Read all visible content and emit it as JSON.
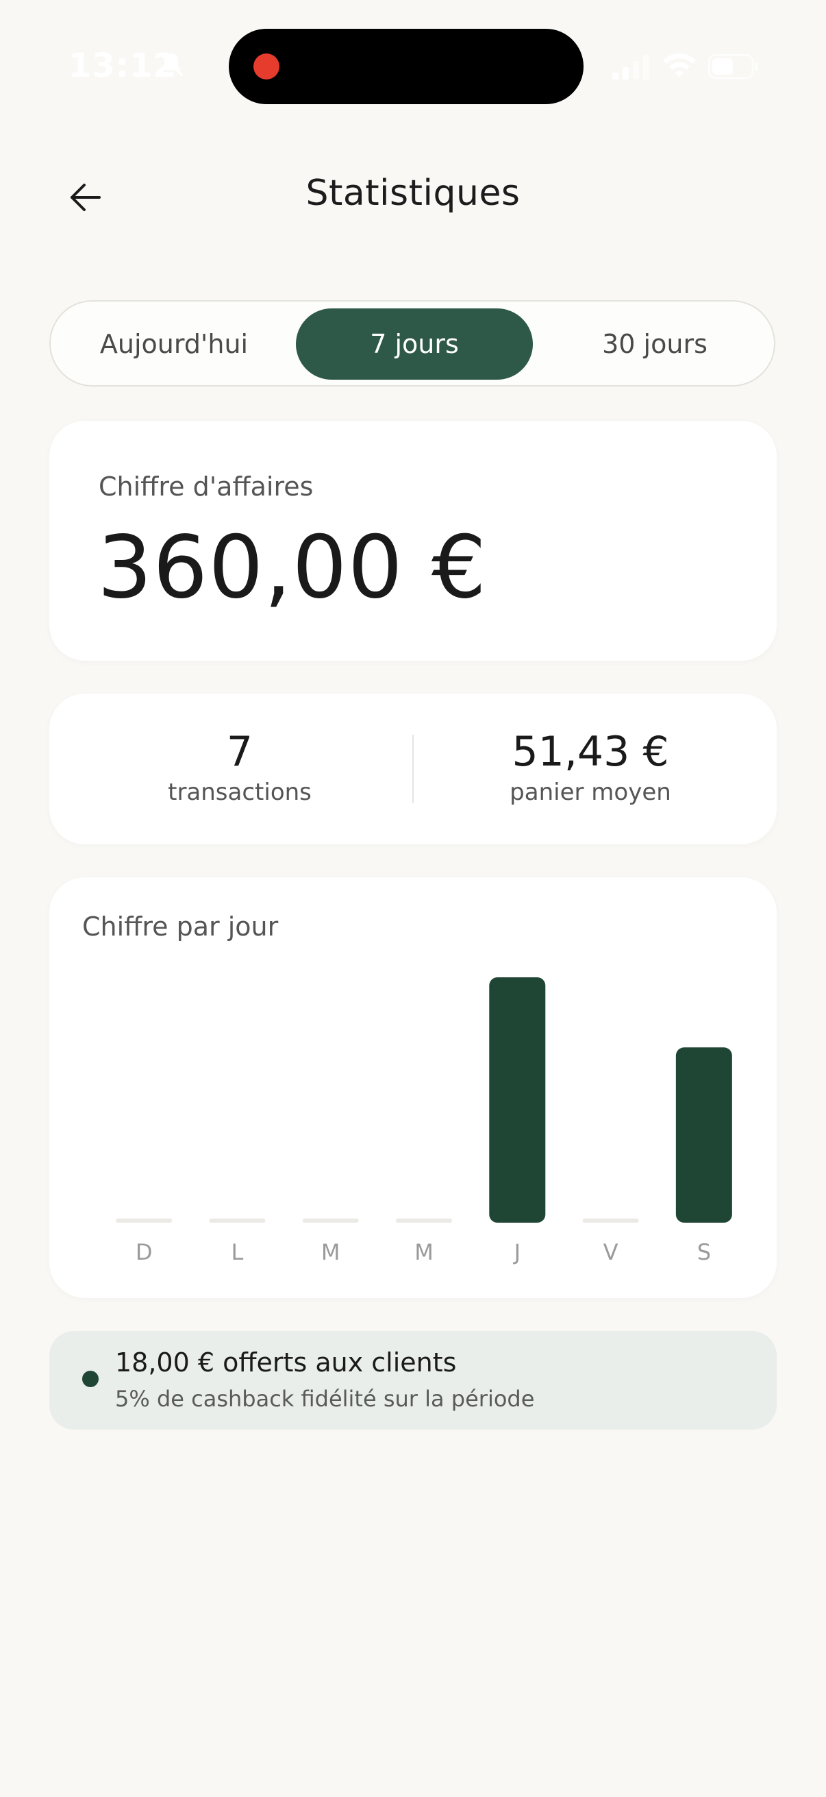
{
  "status_bar": {
    "time": "13:12",
    "icons": [
      "mute-icon",
      "signal-icon",
      "wifi-icon",
      "battery-icon"
    ],
    "recording_indicator_color": "#e53c2e"
  },
  "header": {
    "title": "Statistiques",
    "back_icon": "arrow-left-icon"
  },
  "period_selector": {
    "options": [
      "Aujourd'hui",
      "7 jours",
      "30 jours"
    ],
    "selected": "7 jours",
    "selected_color": "#2e5948"
  },
  "revenue": {
    "label": "Chiffre d'affaires",
    "value": "360,00 €"
  },
  "stats": {
    "transactions_value": "7",
    "transactions_label": "transactions",
    "basket_value": "51,43 €",
    "basket_label": "panier moyen"
  },
  "chart_data": {
    "type": "bar",
    "title": "Chiffre par jour",
    "categories": [
      "D",
      "L",
      "M",
      "M",
      "J",
      "V",
      "S"
    ],
    "values": [
      0,
      0,
      0,
      0,
      210,
      0,
      150
    ],
    "ylim": [
      0,
      210
    ],
    "bar_color": "#1f4534",
    "empty_color": "#eceae5",
    "grid": false
  },
  "cashback": {
    "title": "18,00 € offerts aux clients",
    "subtitle": "5% de cashback fidélité sur la période",
    "dot_color": "#1f4534"
  }
}
